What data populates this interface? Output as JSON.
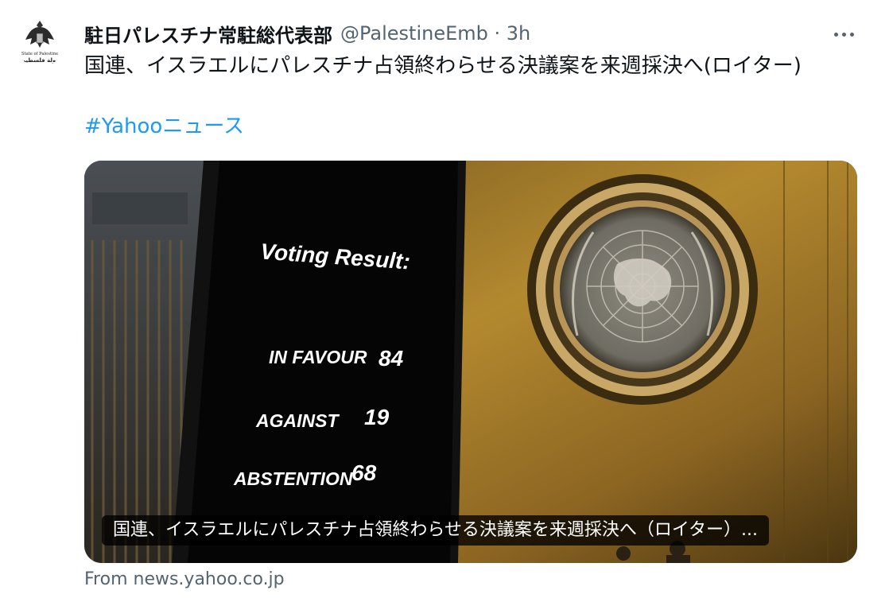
{
  "tweet": {
    "author_name": "駐日パレスチナ常駐総代表部",
    "handle_time": "@PalestineEmb · 3h",
    "text": "国連、イスラエルにパレスチナ占領終わらせる決議案を来週採決へ(ロイター)",
    "hashtag": "#Yahooニュース",
    "avatar_label_en": "State of Palestine",
    "avatar_label_ar": "دولة فلسطين"
  },
  "media": {
    "board_title": "Voting Result:",
    "rows": [
      {
        "label": "IN FAVOUR",
        "value": "84"
      },
      {
        "label": "AGAINST",
        "value": "19"
      },
      {
        "label": "ABSTENTION",
        "value": "68"
      }
    ],
    "caption": "国連、イスラエルにパレスチナ占領終わらせる決議案を来週採決へ（ロイター）..."
  },
  "source": "From news.yahoo.co.jp",
  "icons": [
    "more-options-icon",
    "state-of-palestine-emblem",
    "un-emblem-icon"
  ],
  "colors": {
    "hashtag": "#1d9bf0",
    "secondary_text": "#536471",
    "gold_wall": "#b08830"
  }
}
